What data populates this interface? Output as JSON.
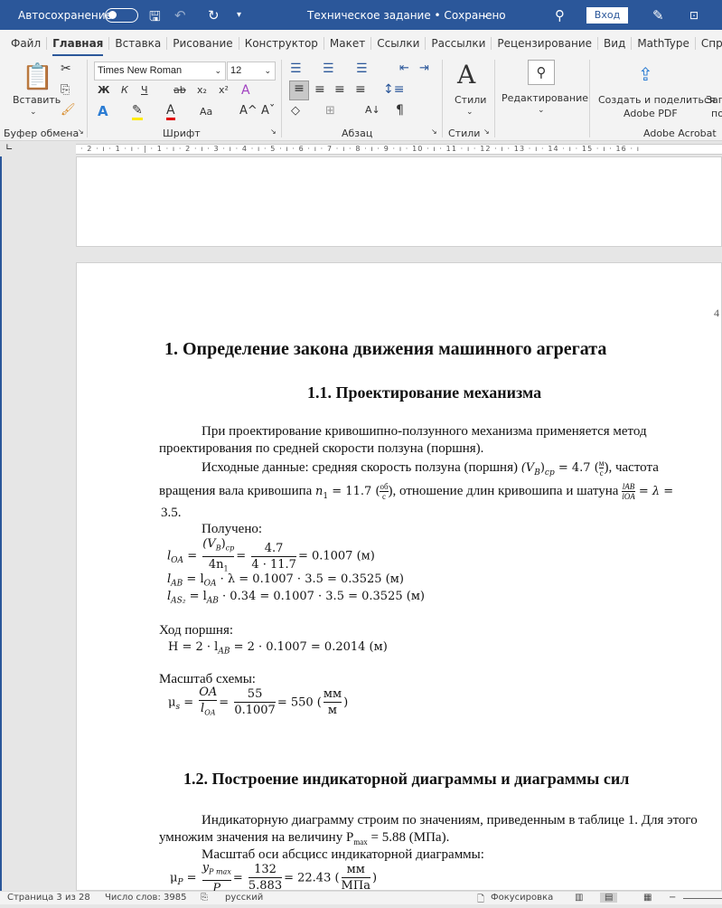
{
  "titlebar": {
    "autosave": "Автосохранение",
    "title": "Техническое задание • Сохранено",
    "login": "Вход"
  },
  "tabs": [
    "Файл",
    "Главная",
    "Вставка",
    "Рисование",
    "Конструктор",
    "Макет",
    "Ссылки",
    "Рассылки",
    "Рецензирование",
    "Вид",
    "MathType",
    "Справка"
  ],
  "ribbon": {
    "paste": "Вставить",
    "font_name": "Times New Roman",
    "font_size": "12",
    "bold": "Ж",
    "italic": "К",
    "underline": "Ч",
    "strike": "ab",
    "sub": "x₂",
    "sup": "x²",
    "change_case": "Aa",
    "grow": "A^",
    "shrink": "Aˇ",
    "pilcrow": "¶",
    "styles": "Стили",
    "editing": "Редактирование",
    "adobe_create": "Создать и поделиться",
    "adobe_pdf": "Adobe PDF",
    "cut_off": "Заг",
    "cut_off2": "по",
    "groups": {
      "clipboard": "Буфер обмена",
      "font": "Шрифт",
      "paragraph": "Абзац",
      "styles": "Стили",
      "acrobat": "Adobe Acrobat"
    }
  },
  "ruler": {
    "ticks": "· 2 · ı · 1 · ı · | · 1 · ı · 2 · ı · 3 · ı · 4 · ı · 5 · ı · 6 · ı · 7 · ı · 8 · ı · 9 · ı · 10 · ı · 11 · ı · 12 · ı · 13 · ı · 14 · ı · 15 · ı · 16 · ı"
  },
  "doc": {
    "page_num": "4",
    "h1": "1.   Определение закона движения машинного агрегата",
    "h2a": "1.1.   Проектирование механизма",
    "p1a": "При проектирование кривошипно-ползунного механизма применяется метод",
    "p1b": "проектирования по средней скорости ползуна (поршня).",
    "p2a": "Исходные данные: средняя скорость ползуна (поршня)",
    "vb": "(V",
    "vb_sub": "B",
    "vb_sub2": "cp",
    "vb_val": " = 4.7 (",
    "unit_m": "м",
    "unit_s": "с",
    "p2a_end": "), частота",
    "p2b": "вращения вала кривошипа",
    "n1": "n",
    "n1_sub": "1",
    "n1_val": " = 11.7 (",
    "unit_ob": "об",
    "p2b_mid": "), отношение длин кривошипа и шатуна",
    "lab": "l",
    "lab_sub": "AB",
    "loa_sub": "OA",
    "lambda_eq": " = λ  =",
    "p2c": "3.5.",
    "got": "Получено:",
    "eq1_lhs": "l",
    "eq1_num1": "(V",
    "eq1_den1": "4n",
    "eq1_num2": "4.7",
    "eq1_den2": "4 · 11.7",
    "eq1_res": "= 0.1007 (м)",
    "eq2": " = l",
    "eq2_res": " · λ =  0.1007 · 3.5 = 0.3525 (м)",
    "eq3_sub": "AS₂",
    "eq3_res": " · 0.34 =  0.1007 · 3.5 = 0.3525 (м)",
    "stroke_label": "Ход поршня:",
    "stroke_eq": "H = 2 · l",
    "stroke_res": " = 2 · 0.1007 = 0.2014 (м)",
    "scale_label": "Масштаб схемы:",
    "mu_s": "μ",
    "mu_s_sub": "s",
    "oa": "OA",
    "frac55": "55",
    "frac_den": "0.1007",
    "scale_res": "= 550 (",
    "unit_mm": "мм",
    "h2b": "1.2.   Построение индикаторной диаграммы и диаграммы сил",
    "p3a": "Индикаторную диаграмму строим по значениям, приведенным в таблице 1. Для этого",
    "p3b": "умножим значения на величину P",
    "p3b_sub": "max",
    "p3b_end": " = 5.88 (МПа).",
    "p4": "Масштаб оси абсцисс индикаторной диаграммы:",
    "mu_p": "μ",
    "mu_p_sub": "P",
    "yp": "y",
    "yp_sub": "P max",
    "p_den": "P",
    "n132": "132",
    "d5883": "5.883",
    "p_res": "= 22.43 (",
    "unit_mpa": "МПа"
  },
  "status": {
    "page": "Страница 3 из 28",
    "words": "Число слов: 3985",
    "lang": "русский",
    "focus": "Фокусировка"
  },
  "colors": {
    "brand": "#2b579a"
  }
}
